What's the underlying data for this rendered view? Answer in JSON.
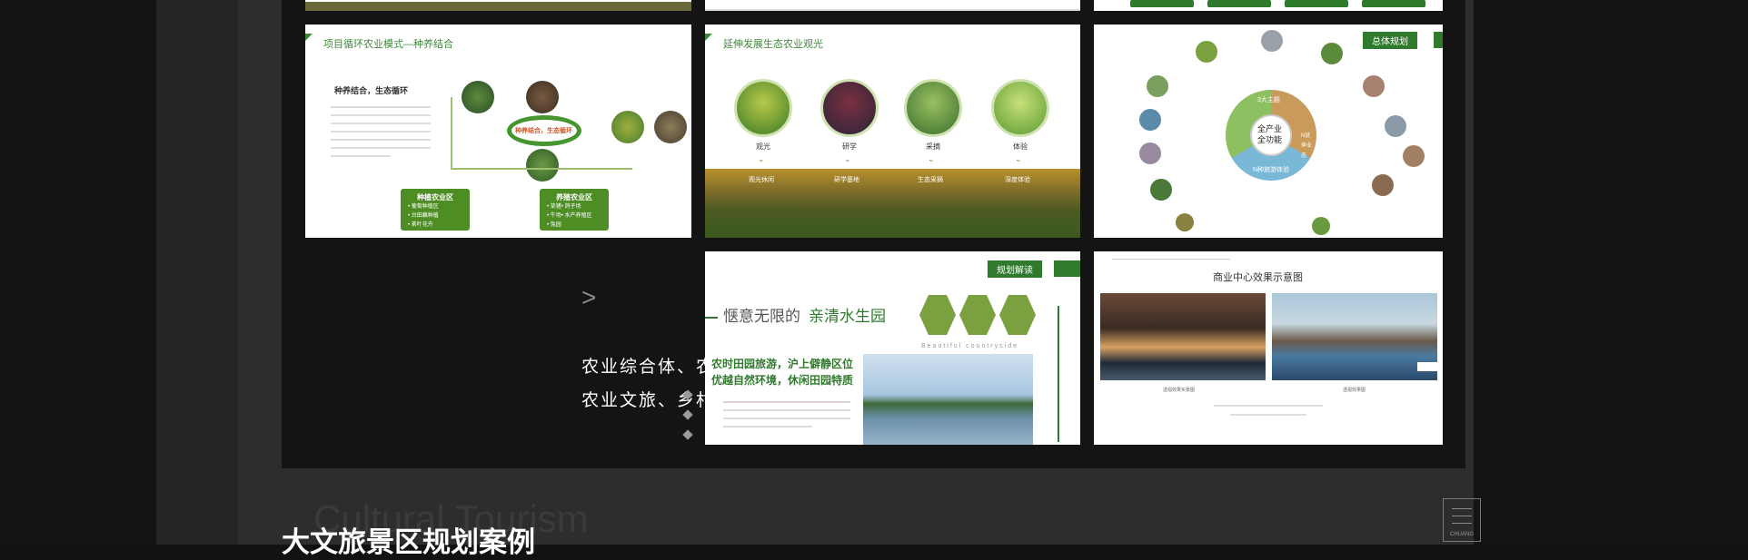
{
  "caption": {
    "arrow": ">",
    "line1": "农业综合体、农村田园、农业生态太园、",
    "line2": "农业文旅、乡村振兴项目规划设计案例"
  },
  "section": {
    "ghost_en": "Cultural Tourism",
    "title": "大文旅景区规划案例",
    "logo_text": "CHUANG"
  },
  "slides": {
    "s1": {
      "title": "项目循环农业模式—种养结合",
      "subtitle": "种养结合，生态循环",
      "center_label": "种养结合，生态循环",
      "box1_title": "种植农业区",
      "box1_items": [
        "• 葡萄种植区",
        "• 台田藕种植",
        "• 茶叶花卉"
      ],
      "box2_title": "养殖农业区",
      "box2_items": [
        "• 草猪• 鸽子场",
        "• 牛场• 水产养殖区",
        "• 兔园"
      ]
    },
    "s2": {
      "title": "延伸发展生态农业观光",
      "labels": [
        "观光",
        "研学",
        "采摘",
        "体验"
      ],
      "band_labels": [
        "观光休闲",
        "研学基地",
        "生态采摘",
        "深度体验"
      ]
    },
    "s3": {
      "banner": "总体规划",
      "core1": "全产业",
      "core2": "全功能",
      "left": "3大主题",
      "right": "N延伸业态",
      "bottom": "N种旅游体验"
    },
    "s4": {
      "banner": "规划解读",
      "headline_a": "惬意无限的",
      "headline_b": "亲清水生园",
      "sub_en": "Beautiful countryside",
      "green_line1": "农时田园旅游，沪上僻静区位",
      "green_line2": "优越自然环境，休闲田园特质"
    },
    "s5": {
      "title": "商业中心效果示意图",
      "cap1": "透视效果实景图",
      "cap2": "透视效果图"
    }
  }
}
